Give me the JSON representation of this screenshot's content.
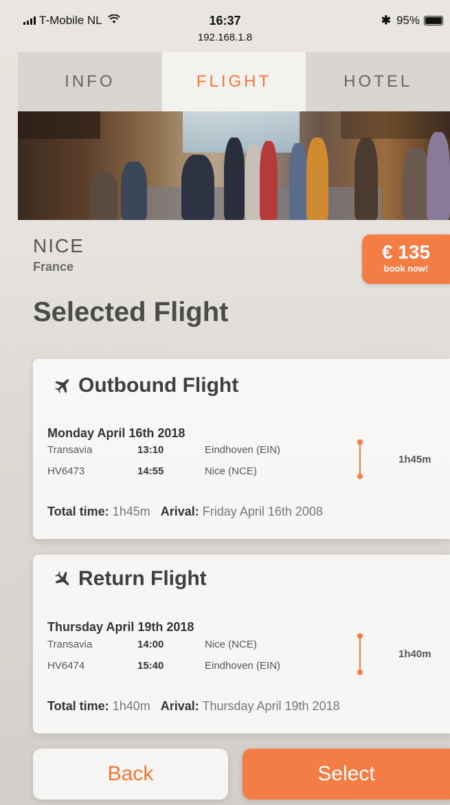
{
  "status_bar": {
    "carrier": "T-Mobile NL",
    "time": "16:37",
    "url": "192.168.1.8",
    "battery": "95%",
    "battery_level": 0.95
  },
  "tabs": [
    {
      "label": "INFO",
      "active": false
    },
    {
      "label": "FLIGHT",
      "active": true
    },
    {
      "label": "HOTEL",
      "active": false
    }
  ],
  "destination": {
    "city": "NICE",
    "country": "France",
    "price": "€ 135",
    "cta": "book now!"
  },
  "section_title": "Selected Flight",
  "outbound": {
    "title": "Outbound Flight",
    "date": "Monday April 16th 2018",
    "airline": "Transavia",
    "flight_no": "HV6473",
    "depart_time": "13:10",
    "arrive_time": "14:55",
    "from": "Eindhoven (EIN)",
    "to": "Nice (NCE)",
    "duration": "1h45m",
    "total_label": "Total time:",
    "total_value": "1h45m",
    "arrival_label": "Arival:",
    "arrival_value": "Friday April 16th 2008"
  },
  "return": {
    "title": "Return Flight",
    "date": "Thursday April 19th 2018",
    "airline": "Transavia",
    "flight_no": "HV6474",
    "depart_time": "14:00",
    "arrive_time": "15:40",
    "from": "Nice (NCE)",
    "to": "Eindhoven (EIN)",
    "duration": "1h40m",
    "total_label": "Total time:",
    "total_value": "1h40m",
    "arrival_label": "Arival:",
    "arrival_value": "Thursday April 19th 2018"
  },
  "buttons": {
    "back": "Back",
    "select": "Select"
  },
  "colors": {
    "accent": "#f47c45",
    "text": "#4a4a4a"
  }
}
